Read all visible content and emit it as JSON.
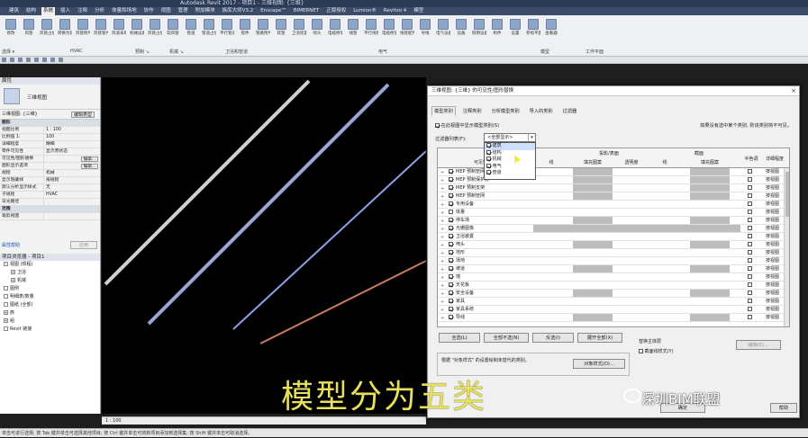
{
  "window": {
    "title": "Autodesk Revit 2017 -   项目1 - 三维视图: {三维}"
  },
  "ribbon_tabs": [
    "建筑",
    "结构",
    "系统",
    "插入",
    "注释",
    "分析",
    "体量和场地",
    "协作",
    "视图",
    "管理",
    "附加模块",
    "族库大师V3.2",
    "Enscape™",
    "BIMERNET",
    "正版授权",
    "Lumion®",
    "Revitzo 4",
    "模型"
  ],
  "ribbon_tabs_left": [
    "机械设",
    "电气设",
    "风道",
    "管道",
    "给排水",
    "暖通",
    "模型",
    "坐标系",
    "分析",
    "体量与场地",
    "协作",
    "视图"
  ],
  "ribbon": {
    "buttons": [
      "修改",
      "风管",
      "风管占位符",
      "转换为软风管",
      "风管附件",
      "风管管件",
      "风道末端",
      "机械设备",
      "风管占位符",
      "软风管",
      "管道",
      "管道占位符",
      "平行管道",
      "管件",
      "管路附件",
      "软管",
      "卫浴装置",
      "喷头",
      "电缆桥架",
      "线管",
      "平行线管",
      "电缆桥架配件",
      "线管配件",
      "导线",
      "电气设备",
      "设备",
      "照明设备",
      "构件",
      "设置",
      "参照平面",
      "查看器"
    ],
    "groups": [
      "选择 ▾",
      "HVAC",
      "预制 ↘",
      "机械 ↘",
      "卫浴和管道",
      "电气",
      "模型",
      "工作平面"
    ]
  },
  "properties": {
    "header": "属性",
    "type_name": "三维视图",
    "selector": "三维视图: {三维}",
    "edit_type": "编辑类型",
    "section_graphics": "图形",
    "rows": [
      {
        "k": "视图比例",
        "v": "1 : 100"
      },
      {
        "k": "比例值 1:",
        "v": "100"
      },
      {
        "k": "详细程度",
        "v": "精细"
      },
      {
        "k": "零件可见性",
        "v": "显示原状态"
      },
      {
        "k": "可见性/图形替换",
        "v": "",
        "btn": "编辑..."
      },
      {
        "k": "图形显示选项",
        "v": "",
        "btn": "编辑..."
      },
      {
        "k": "规程",
        "v": "机械"
      },
      {
        "k": "显示隐藏线",
        "v": "按规程"
      },
      {
        "k": "默认分析显示样式",
        "v": "无"
      },
      {
        "k": "子规程",
        "v": "HVAC"
      },
      {
        "k": "日光路径",
        "v": ""
      }
    ],
    "section_extents": "范围",
    "row_last": "裁剪视图",
    "help_link": "属性帮助",
    "apply": "应用"
  },
  "browser": {
    "header": "项目浏览器 - 项目1",
    "items": [
      {
        "label": "视图 (规程)",
        "level": 0,
        "ex": "−"
      },
      {
        "label": "卫浴",
        "level": 1,
        "ex": "+"
      },
      {
        "label": "机械",
        "level": 1,
        "ex": "+"
      },
      {
        "label": "图例",
        "level": 0,
        "ex": ""
      },
      {
        "label": "明细表/数量",
        "level": 0,
        "ex": ""
      },
      {
        "label": "图纸 (全部)",
        "level": 0,
        "ex": ""
      },
      {
        "label": "族",
        "level": 0,
        "ex": "+"
      },
      {
        "label": "组",
        "level": 0,
        "ex": "+"
      },
      {
        "label": "Revit 链接",
        "level": 0,
        "ex": ""
      }
    ]
  },
  "viewbar": {
    "scale": "1 : 100"
  },
  "status": {
    "text": "单击可进行选择; 按 Tab 键并单击可选择其他项目; 按 Ctrl 键并单击可将新项目添加到选择集; 按 Shift 键并单击可取消选择。"
  },
  "dialog": {
    "title": "三维视图: {三维} 的可见性/图形替换",
    "tabs": [
      "模型类别",
      "注释类别",
      "分析模型类别",
      "导入的类别",
      "过滤器"
    ],
    "show_label": "在此视图中显示模型类别(S)",
    "hint": "如果没有选中某个类别, 则该类别将不可见。",
    "filter_label": "过滤器列表(F):",
    "filter_value": "<全部显示>",
    "filter_options": [
      "建筑",
      "结构",
      "机械",
      "电气",
      "管道"
    ],
    "headers": {
      "visibility": "可见性",
      "projection": "投影/表面",
      "cut": "截面",
      "lines": "线",
      "patterns": "填充图案",
      "transparency": "透明度",
      "halftone": "半色调",
      "detail": "详细程度"
    },
    "rows": [
      {
        "name": "MEP 预制管网",
        "checked": true
      },
      {
        "name": "MEP 预制保护层",
        "checked": true
      },
      {
        "name": "MEP 预制支架",
        "checked": true
      },
      {
        "name": "MEP 预制管网",
        "checked": true
      },
      {
        "name": "专用设备",
        "checked": true
      },
      {
        "name": "体量",
        "checked": false
      },
      {
        "name": "停车场",
        "checked": true
      },
      {
        "name": "光栅图像",
        "checked": true
      },
      {
        "name": "卫浴装置",
        "checked": true
      },
      {
        "name": "喷头",
        "checked": true
      },
      {
        "name": "地形",
        "checked": true
      },
      {
        "name": "场地",
        "checked": true
      },
      {
        "name": "坡道",
        "checked": true
      },
      {
        "name": "墙",
        "checked": true
      },
      {
        "name": "天花板",
        "checked": true
      },
      {
        "name": "安全设备",
        "checked": true
      },
      {
        "name": "家具",
        "checked": true
      },
      {
        "name": "家具系统",
        "checked": true
      },
      {
        "name": "导线",
        "checked": true
      }
    ],
    "override_text": "按视图",
    "btn_all": "全选(L)",
    "btn_none": "全部不选(N)",
    "btn_invert": "反选(I)",
    "btn_expand": "展开全部(X)",
    "override_host": "替换主体层",
    "cut_line_styles": "截面线样式(Y)",
    "edit_btn": "编辑(E)...",
    "object_styles_note": "根据 \"对象样式\" 的设置绘制未替代的类别。",
    "object_styles_btn": "对象样式(O)...",
    "ok": "确定",
    "help": "帮助"
  },
  "overlay": {
    "caption": "模型分为五类",
    "watermark": "深圳BIM联盟"
  },
  "colors": {
    "tab_bg": "#3b4b68",
    "line1": "#d0d0d0",
    "line2": "#9aa4d6",
    "line3": "#8ea0e8",
    "line4": "#c77a66",
    "caption": "#e8e05a"
  }
}
